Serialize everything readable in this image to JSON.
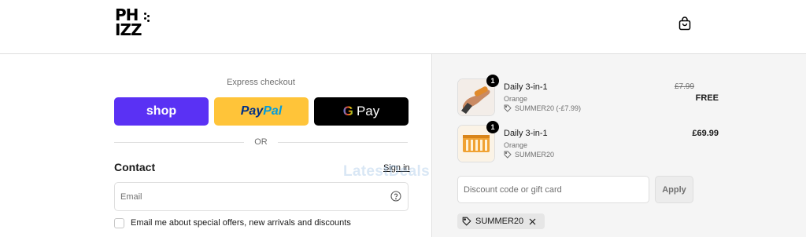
{
  "brand": {
    "logo_line1": "PH",
    "logo_line2": "IZZ"
  },
  "header": {
    "cart_icon": "shopping-bag-icon"
  },
  "express": {
    "label": "Express checkout",
    "shop_label": "shop",
    "paypal_part1": "Pay",
    "paypal_part2": "Pal",
    "gpay_g": "G",
    "gpay_label": "Pay",
    "or_label": "OR"
  },
  "contact": {
    "title": "Contact",
    "signin_label": "Sign in",
    "email_placeholder": "Email",
    "email_value": "",
    "newsletter_label": "Email me about special offers, new arrivals and discounts",
    "newsletter_checked": false
  },
  "watermark": "LatestDeals",
  "order": {
    "items": [
      {
        "quantity": "1",
        "name": "Daily 3-in-1",
        "variant": "Orange",
        "discount": "SUMMER20 (-£7.99)",
        "price_original": "£7.99",
        "price": "FREE"
      },
      {
        "quantity": "1",
        "name": "Daily 3-in-1",
        "variant": "Orange",
        "discount": "SUMMER20",
        "price": "£69.99"
      }
    ],
    "discount_placeholder": "Discount code or gift card",
    "discount_value": "",
    "apply_label": "Apply",
    "applied_code": "SUMMER20"
  },
  "colors": {
    "shop": "#5a31f4",
    "paypal": "#ffc439",
    "gpay": "#000000",
    "summary_bg": "#f5f5f5"
  }
}
